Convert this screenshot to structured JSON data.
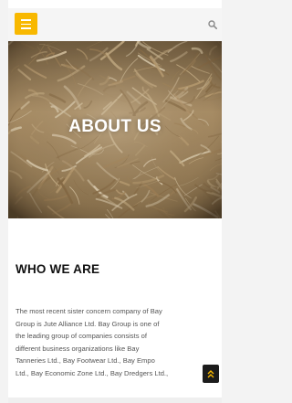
{
  "header": {
    "menu_icon": "hamburger-icon",
    "search_icon": "search-icon",
    "accent_color": "#f8b800"
  },
  "hero": {
    "title": "ABOUT US"
  },
  "section": {
    "heading": "WHO WE ARE",
    "lines": [
      "The most recent sister concern company of Bay",
      "Group is Jute Alliance Ltd. Bay Group is one of",
      "the leading group of companies consists of",
      "different business organizations like Bay",
      "Tanneries Ltd., Bay Footwear Ltd., Bay Empo",
      "Ltd., Bay Economic Zone Ltd., Bay Dredgers Ltd.,"
    ]
  },
  "scroll_top": {
    "icon": "double-chevron-up-icon"
  }
}
